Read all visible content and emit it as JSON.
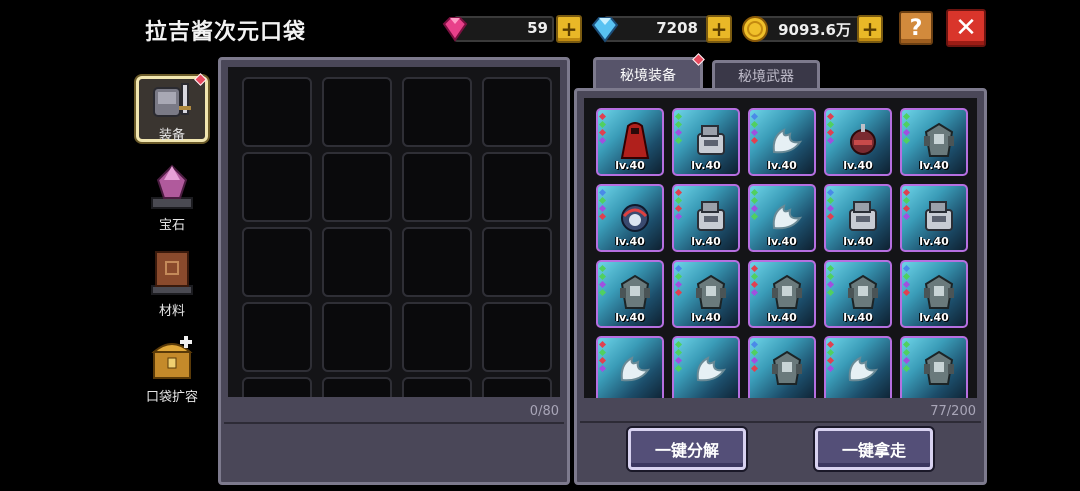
{
  "header": {
    "title": "拉吉酱次元口袋"
  },
  "currencies": [
    {
      "name": "pink-gem",
      "value": "59",
      "color": "#e5407a"
    },
    {
      "name": "diamond",
      "value": "7208",
      "color": "#5fc6f0"
    },
    {
      "name": "gold-coin",
      "value": "9093.6万",
      "color": "#f0c02a"
    }
  ],
  "buttons": {
    "help": "?",
    "close": "✕",
    "decompose_all": "一键分解",
    "take_all": "一键拿走"
  },
  "sidebar": {
    "items": [
      {
        "label": "装备",
        "icon": "armor-icon",
        "active": true,
        "badge": true
      },
      {
        "label": "宝石",
        "icon": "gem-icon",
        "active": false
      },
      {
        "label": "材料",
        "icon": "book-icon",
        "active": false
      },
      {
        "label": "口袋扩容",
        "icon": "chest-icon",
        "active": false
      }
    ]
  },
  "bag": {
    "count": "0/80"
  },
  "tabs": [
    {
      "label": "秘境装备",
      "active": true,
      "badge": true
    },
    {
      "label": "秘境武器",
      "active": false
    }
  ],
  "secret_items": {
    "count": "77/200",
    "items": [
      {
        "level": "lv.40",
        "art": "red-robe"
      },
      {
        "level": "lv.40",
        "art": "silver-gauntlet"
      },
      {
        "level": "lv.40",
        "art": "cloud-wing"
      },
      {
        "level": "lv.40",
        "art": "red-helm"
      },
      {
        "level": "lv.40",
        "art": "dark-armor"
      },
      {
        "level": "lv.40",
        "art": "shield-orb"
      },
      {
        "level": "lv.40",
        "art": "silver-gauntlet"
      },
      {
        "level": "lv.40",
        "art": "cloud-wing"
      },
      {
        "level": "lv.40",
        "art": "silver-gauntlet"
      },
      {
        "level": "lv.40",
        "art": "silver-gauntlet"
      },
      {
        "level": "lv.40",
        "art": "dark-armor"
      },
      {
        "level": "lv.40",
        "art": "dark-armor"
      },
      {
        "level": "lv.40",
        "art": "dark-armor"
      },
      {
        "level": "lv.40",
        "art": "dark-armor"
      },
      {
        "level": "lv.40",
        "art": "dark-armor"
      },
      {
        "level": "",
        "art": "cloud-wing"
      },
      {
        "level": "",
        "art": "cloud-wing"
      },
      {
        "level": "",
        "art": "dark-armor"
      },
      {
        "level": "",
        "art": "cloud-wing"
      },
      {
        "level": "",
        "art": "dark-armor"
      }
    ]
  }
}
